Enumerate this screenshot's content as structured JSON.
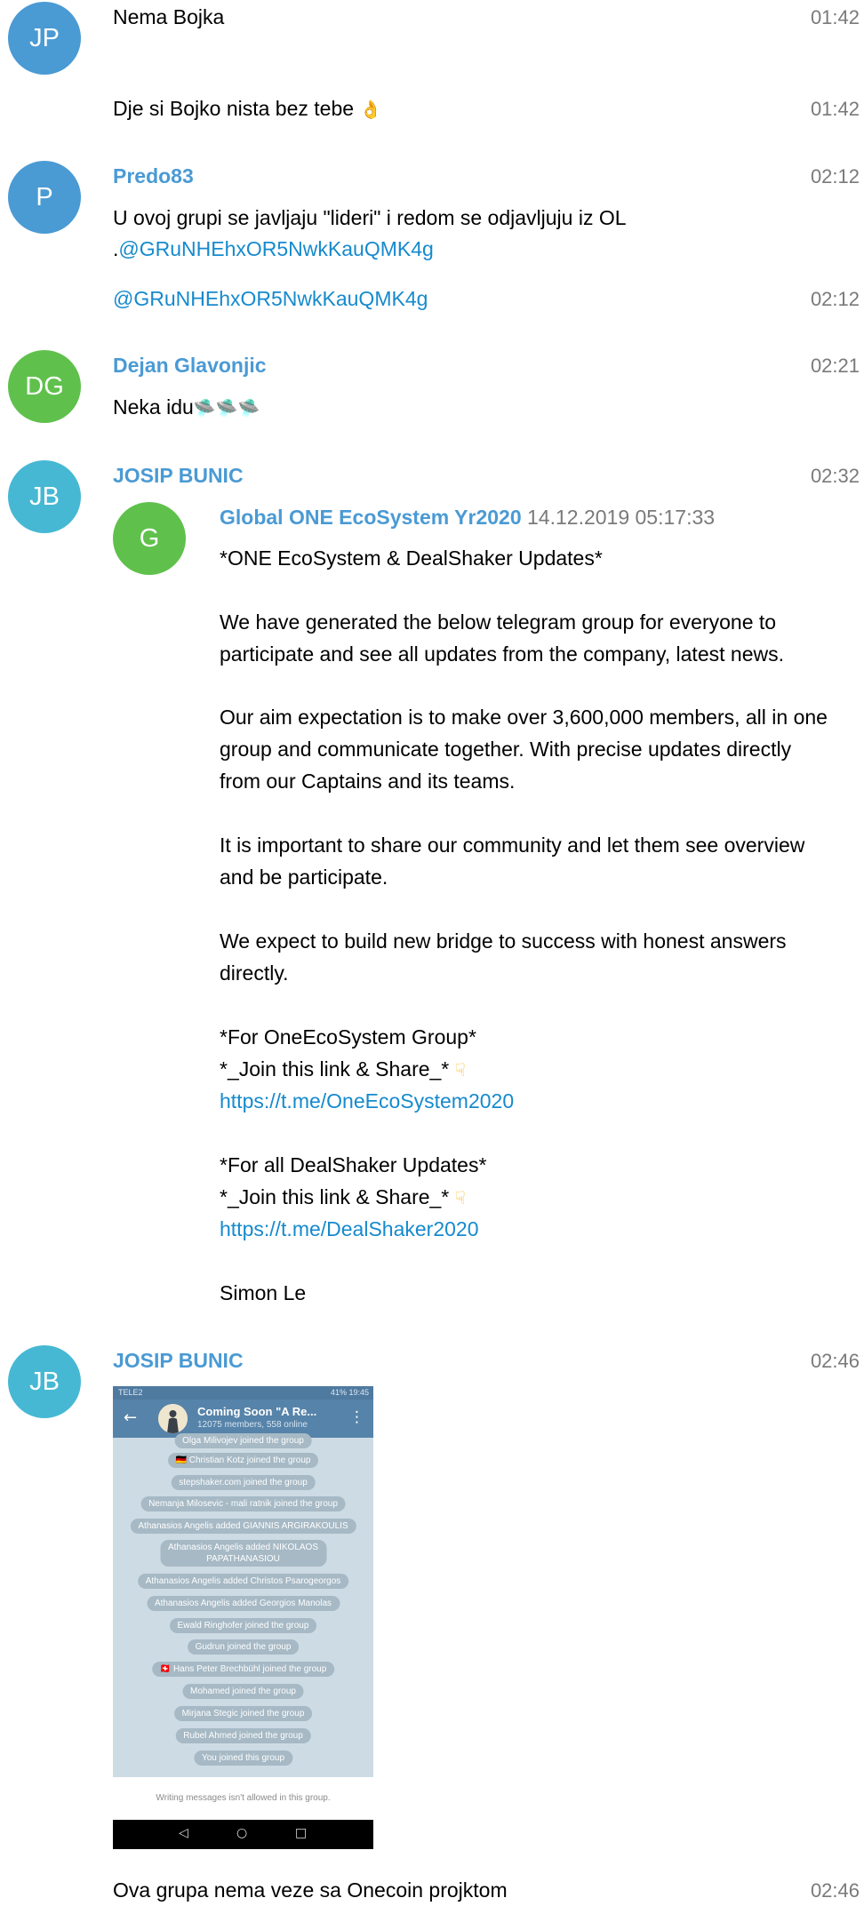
{
  "colors": {
    "blue": "#4a9ad4",
    "green": "#5fc14c",
    "teal": "#46b8d3",
    "link": "#168acd"
  },
  "messages": {
    "m1": {
      "initials": "JP",
      "text": "Nema Bojka",
      "time": "01:42"
    },
    "m2": {
      "text": "Dje si Bojko nista bez tebe",
      "emoji": "👌",
      "time": "01:42"
    },
    "m3": {
      "initials": "P",
      "sender": "Predo83",
      "line1": "U ovoj grupi se javljaju \"lideri\" i redom se odjavljuju iz OL",
      "line2_prefix": ".",
      "line2_link": "@GRuNHEhxOR5NwkKauQMK4g",
      "time": "02:12"
    },
    "m4": {
      "link": "@GRuNHEhxOR5NwkKauQMK4g",
      "time": "02:12"
    },
    "m5": {
      "initials": "DG",
      "sender": "Dejan Glavonjic",
      "text": "Neka idu",
      "emoji": "🛸🛸🛸",
      "time": "02:21"
    },
    "m6": {
      "initials": "JB",
      "sender": "JOSIP BUNIC",
      "time": "02:32",
      "forward": {
        "initials": "G",
        "from": "Global ONE EcoSystem Yr2020",
        "date": "14.12.2019 05:17:33",
        "l1": "*ONE EcoSystem & DealShaker Updates*",
        "l2": "We have generated the below telegram group for everyone to",
        "l3": "participate and see all updates from the company, latest news.",
        "l4": "Our aim expectation is to make over 3,600,000 members, all in one",
        "l5": "group and communicate together. With precise updates directly",
        "l6": "from our Captains and its teams.",
        "l7": "It is important to share our community and let them see overview",
        "l8": "and be participate.",
        "l9": "We expect to build new bridge to success with honest answers",
        "l10": "directly.",
        "l11": "*For OneEcoSystem Group*",
        "l12": "*_Join this link & Share_*",
        "link1": "https://t.me/OneEcoSystem2020",
        "l13": "*For all DealShaker Updates*",
        "l14": "*_Join this link & Share_*",
        "link2": "https://t.me/DealShaker2020",
        "l15": "Simon Le"
      }
    },
    "m7": {
      "initials": "JB",
      "sender": "JOSIP BUNIC",
      "time": "02:46",
      "screenshot": {
        "status_left": "TELE2",
        "status_right": "41% 19:45",
        "title": "Coming Soon \"A Re...",
        "subtitle": "12075 members, 558 online",
        "events": [
          "Olga Milivojev joined the group",
          "🇩🇪 Christian Kotz joined the group",
          "stepshaker.com joined the group",
          "Nemanja Milosevic - mali ratnik joined the group",
          "Athanasios Angelis added GIANNIS ARGIRAKOULIS",
          "Athanasios Angelis added NIKOLAOS",
          "PAPATHANASIOU",
          "Athanasios Angelis added Christos Psarogeorgos",
          "Athanasios Angelis added Georgios Manolas",
          "Ewald Ringhofer joined the group",
          "Gudrun joined the group",
          "🇨🇭 Hans Peter Brechbühl joined the group",
          "Mohamed joined the group",
          "Mirjana Stegic joined the group",
          "Rubel Ahmed joined the group",
          "You joined this group"
        ],
        "footer": "Writing messages isn't allowed in this group."
      }
    },
    "m8": {
      "text": "Ova grupa nema veze sa Onecoin projktom",
      "time": "02:46"
    }
  }
}
